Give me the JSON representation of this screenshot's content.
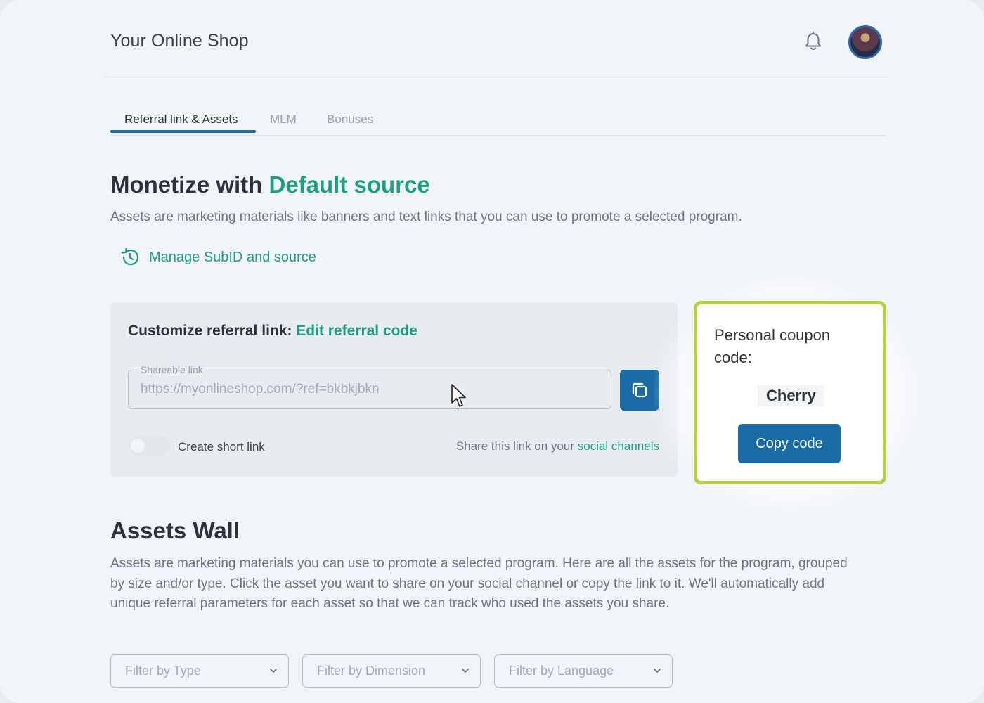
{
  "header": {
    "shop_title": "Your Online Shop",
    "bell_icon": "bell-icon",
    "avatar": "user-avatar"
  },
  "tabs": [
    {
      "label": "Referral link & Assets",
      "active": true
    },
    {
      "label": "MLM",
      "active": false
    },
    {
      "label": "Bonuses",
      "active": false
    }
  ],
  "monetize": {
    "title_prefix": "Monetize with",
    "title_accent": "Default source",
    "description": "Assets are marketing materials like banners and text links that you can use to promote a selected program.",
    "manage_link": "Manage SubID and source",
    "manage_icon": "history-icon"
  },
  "referral": {
    "title_prefix": "Customize referral link:",
    "title_link": "Edit referral code",
    "field_label": "Shareable link",
    "field_value": "https://myonlineshop.com/?ref=bkbkjbkn",
    "copy_icon": "copy-icon",
    "short_link_label": "Create short link",
    "short_link_enabled": false,
    "share_prefix": "Share this link on your",
    "share_link": "social channels"
  },
  "coupon": {
    "title": "Personal coupon code:",
    "code": "Cherry",
    "button": "Copy code"
  },
  "assets_wall": {
    "title": "Assets Wall",
    "description": "Assets are marketing materials you can use to promote a selected program. Here are all the assets for the program, grouped by size and/or type. Click the asset you want to share on your social channel or copy the link to it. We'll automatically add unique referral parameters for each asset so that we can track who used the assets you share.",
    "filters": [
      "Filter by Type",
      "Filter by Dimension",
      "Filter by Language"
    ]
  },
  "colors": {
    "accent_green": "#1e9e7f",
    "primary_blue": "#1a6aa6",
    "highlight_border": "#b5d14c"
  }
}
